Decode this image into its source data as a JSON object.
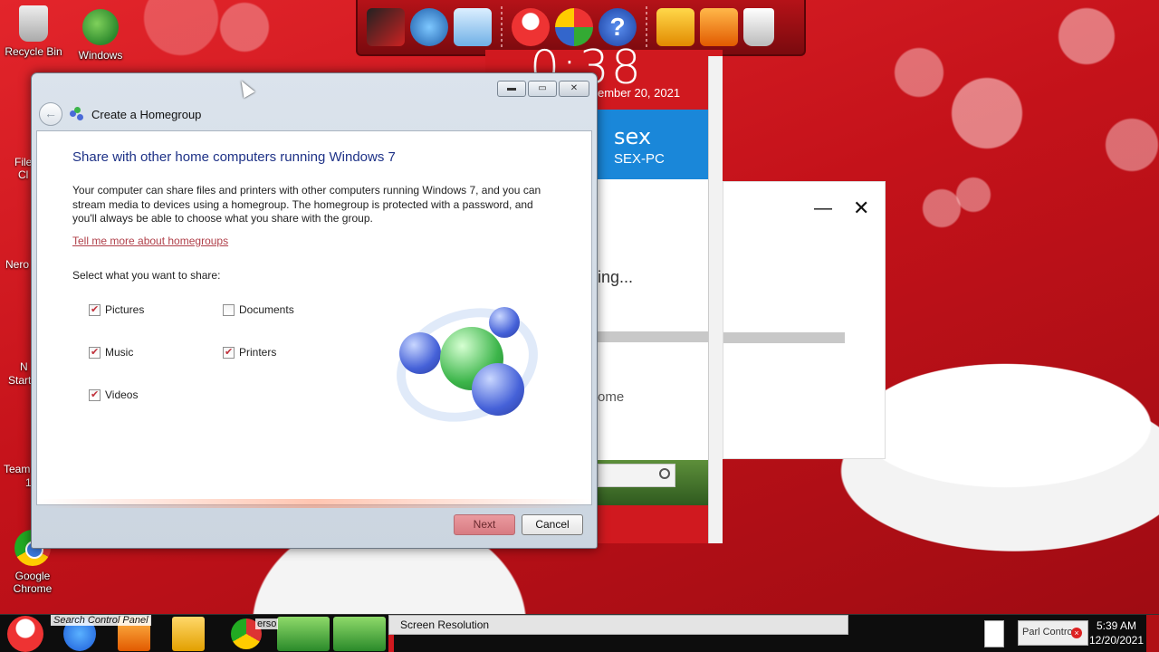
{
  "desktop": {
    "icons": [
      {
        "label": "Recycle Bin"
      },
      {
        "label": "Windows"
      },
      {
        "label": "Google Chrome"
      }
    ],
    "partial_labels": [
      "File",
      "Cl",
      "Nero",
      "N",
      "Start",
      "Team",
      "1"
    ]
  },
  "metro": {
    "clock_fragment": "0:38",
    "date_fragment": "ember 20, 2021",
    "user_name": "sex",
    "user_pc": "SEX-PC",
    "loading_fragment": "ing...",
    "home_fragment": "ome"
  },
  "dialog": {
    "title": "Create a Homegroup",
    "heading": "Share with other home computers running Windows 7",
    "description": "Your computer can share files and printers with other computers running Windows 7, and you can stream media to devices using a homegroup. The homegroup is protected with a password, and you'll always be able to choose what you share with the group.",
    "link": "Tell me more about homegroups",
    "select_label": "Select what you want to share:",
    "options": [
      {
        "label": "Pictures",
        "checked": true
      },
      {
        "label": "Documents",
        "checked": false
      },
      {
        "label": "Music",
        "checked": true
      },
      {
        "label": "Printers",
        "checked": true
      },
      {
        "label": "Videos",
        "checked": true
      }
    ],
    "next_label": "Next",
    "cancel_label": "Cancel",
    "minimize_glyph": "▬",
    "maximize_glyph": "▭",
    "close_glyph": "✕"
  },
  "right_dialog": {
    "minimize_glyph": "—",
    "close_glyph": "✕"
  },
  "taskbar": {
    "overlay_text": "Search Control Panel",
    "overlay_text2": "erso",
    "active_window": "Screen Resolution",
    "tray_text": "Parl Contro",
    "time": "5:39 AM",
    "date": "12/20/2021"
  },
  "colors": {
    "accent": "#d0191f",
    "metro_tile": "#1a87d9",
    "link": "#b0404a",
    "heading": "#1e3287"
  }
}
